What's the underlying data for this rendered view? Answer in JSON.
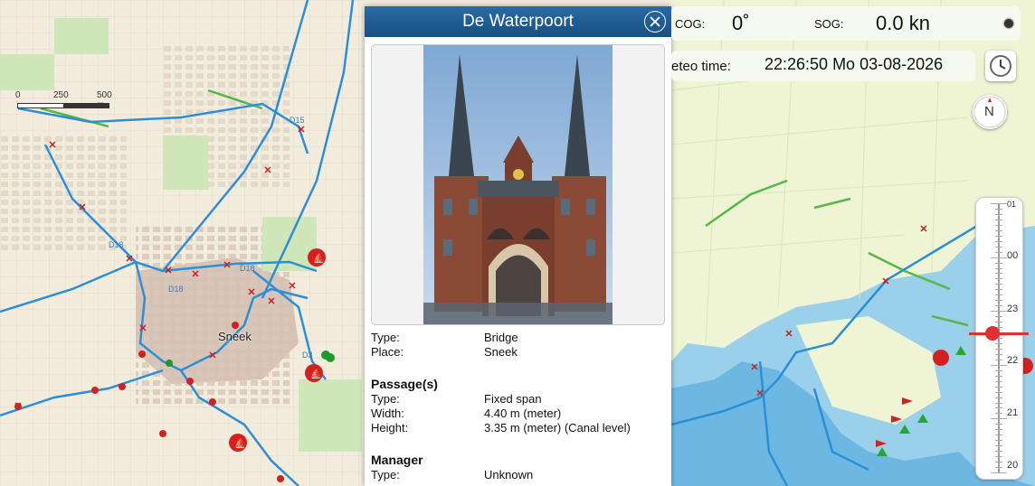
{
  "panel": {
    "title": "De Waterpoort",
    "close_icon": "close-circle-icon",
    "details": {
      "type_key": "Type:",
      "type_val": "Bridge",
      "place_key": "Place:",
      "place_val": "Sneek"
    },
    "passage": {
      "heading": "Passage(s)",
      "type_key": "Type:",
      "type_val": "Fixed span",
      "width_key": "Width:",
      "width_val": "4.40 m (meter)",
      "height_key": "Height:",
      "height_val": "3.35 m (meter) (Canal level)"
    },
    "manager": {
      "heading": "Manager",
      "type_key": "Type:",
      "type_val": "Unknown"
    }
  },
  "nav": {
    "cog_label": "COG:",
    "cog_value": "0˚",
    "sog_label": "SOG:",
    "sog_value": "0.0 kn",
    "meteo_label": "eteo time:",
    "meteo_value": "22:26:50 Mo 03-08-2026",
    "compass_label": "N"
  },
  "scale": {
    "ticks": [
      "01",
      "00",
      "23",
      "22",
      "21",
      "20"
    ],
    "level": 0.48
  },
  "map": {
    "scalebar": [
      "0",
      "250",
      "500 m"
    ],
    "city": "Sneek",
    "routes": [
      "D15",
      "D18",
      "D18",
      "D18",
      "D3"
    ]
  },
  "colors": {
    "water": "#2b8fd8",
    "panel_header": "#1f5f95",
    "marker_red": "#d42020"
  }
}
